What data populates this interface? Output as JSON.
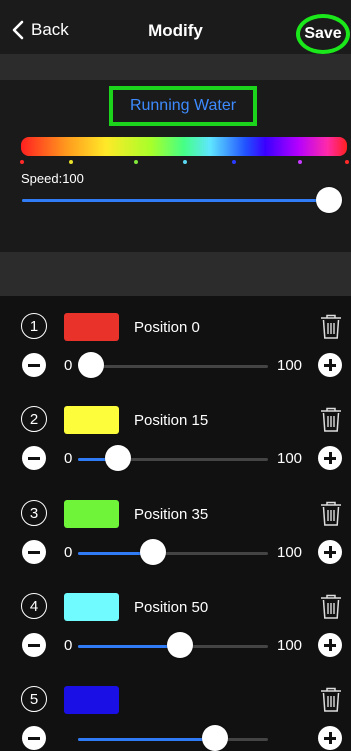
{
  "nav": {
    "back_label": "Back",
    "title": "Modify",
    "save_label": "Save"
  },
  "mode": {
    "name": "Running Water"
  },
  "speed": {
    "label": "Speed:100",
    "value_fraction": 1.0
  },
  "spectrum_dot_colors": [
    "#ff2a2a",
    "#e8e02a",
    "#7fe83a",
    "#5ad8f0",
    "#2a3cff",
    "#c83aff",
    "#ff2a2a"
  ],
  "colors": [
    {
      "number": "1",
      "swatch": "#e8322a",
      "label": "Position 0",
      "min": "0",
      "max": "100",
      "fraction": 0.0
    },
    {
      "number": "2",
      "swatch": "#fdfd3c",
      "label": "Position 15",
      "min": "0",
      "max": "100",
      "fraction": 0.15
    },
    {
      "number": "3",
      "swatch": "#70f43a",
      "label": "Position 35",
      "min": "0",
      "max": "100",
      "fraction": 0.35
    },
    {
      "number": "4",
      "swatch": "#6ffbff",
      "label": "Position 50",
      "min": "0",
      "max": "100",
      "fraction": 0.5
    },
    {
      "number": "5",
      "swatch": "#1a10e6",
      "label": "",
      "min": "",
      "max": "",
      "fraction": 0.7
    }
  ],
  "icons": {
    "back": "chevron-left-icon",
    "delete": "trash-icon",
    "decrease": "minus-circle-icon",
    "increase": "plus-circle-icon"
  }
}
